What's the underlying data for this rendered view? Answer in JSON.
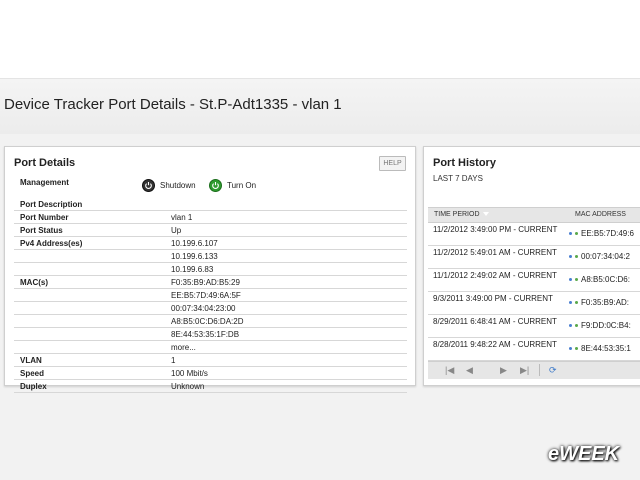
{
  "page": {
    "title": "Device Tracker Port Details - St.P-Adt1335 - vlan 1"
  },
  "port_details": {
    "title": "Port Details",
    "help_label": "HELP",
    "management_label": "Management",
    "shutdown_label": "Shutdown",
    "turn_on_label": "Turn On",
    "rows": [
      {
        "key": "Port Description",
        "value": ""
      },
      {
        "key": "Port Number",
        "value": "vlan 1"
      },
      {
        "key": "Port Status",
        "value": "Up"
      },
      {
        "key": "Pv4 Address(es)",
        "value": "10.199.6.107"
      },
      {
        "key": "",
        "value": "10.199.6.133"
      },
      {
        "key": "",
        "value": "10.199.6.83"
      },
      {
        "key": "MAC(s)",
        "value": "F0:35:B9:AD:B5:29"
      },
      {
        "key": "",
        "value": "EE:B5:7D:49:6A:5F"
      },
      {
        "key": "",
        "value": "00:07:34:04:23:00"
      },
      {
        "key": "",
        "value": "A8:B5:0C:D6:DA:2D"
      },
      {
        "key": "",
        "value": "8E:44:53:35:1F:DB"
      },
      {
        "key": "",
        "value": "more..."
      },
      {
        "key": "VLAN",
        "value": "1"
      },
      {
        "key": "Speed",
        "value": "100 Mbit/s"
      },
      {
        "key": "Duplex",
        "value": "Unknown"
      }
    ]
  },
  "port_history": {
    "title": "Port History",
    "subtitle": "LAST 7 DAYS",
    "col_time": "TIME PERIOD",
    "col_mac": "MAC ADDRESS",
    "rows": [
      {
        "time": "11/2/2012 3:49:00 PM - CURRENT",
        "mac": "EE:B5:7D:49:6"
      },
      {
        "time": "11/2/2012 5:49:01 AM - CURRENT",
        "mac": "00:07:34:04:2"
      },
      {
        "time": "11/1/2012 2:49:02 AM - CURRENT",
        "mac": "A8:B5:0C:D6:"
      },
      {
        "time": "9/3/2011 3:49:00 PM - CURRENT",
        "mac": "F0:35:B9:AD:"
      },
      {
        "time": "8/29/2011 6:48:41 AM - CURRENT",
        "mac": "F9:DD:0C:B4:"
      },
      {
        "time": "8/28/2011 9:48:22 AM - CURRENT",
        "mac": "8E:44:53:35:1"
      }
    ]
  },
  "watermark": "eWEEK"
}
